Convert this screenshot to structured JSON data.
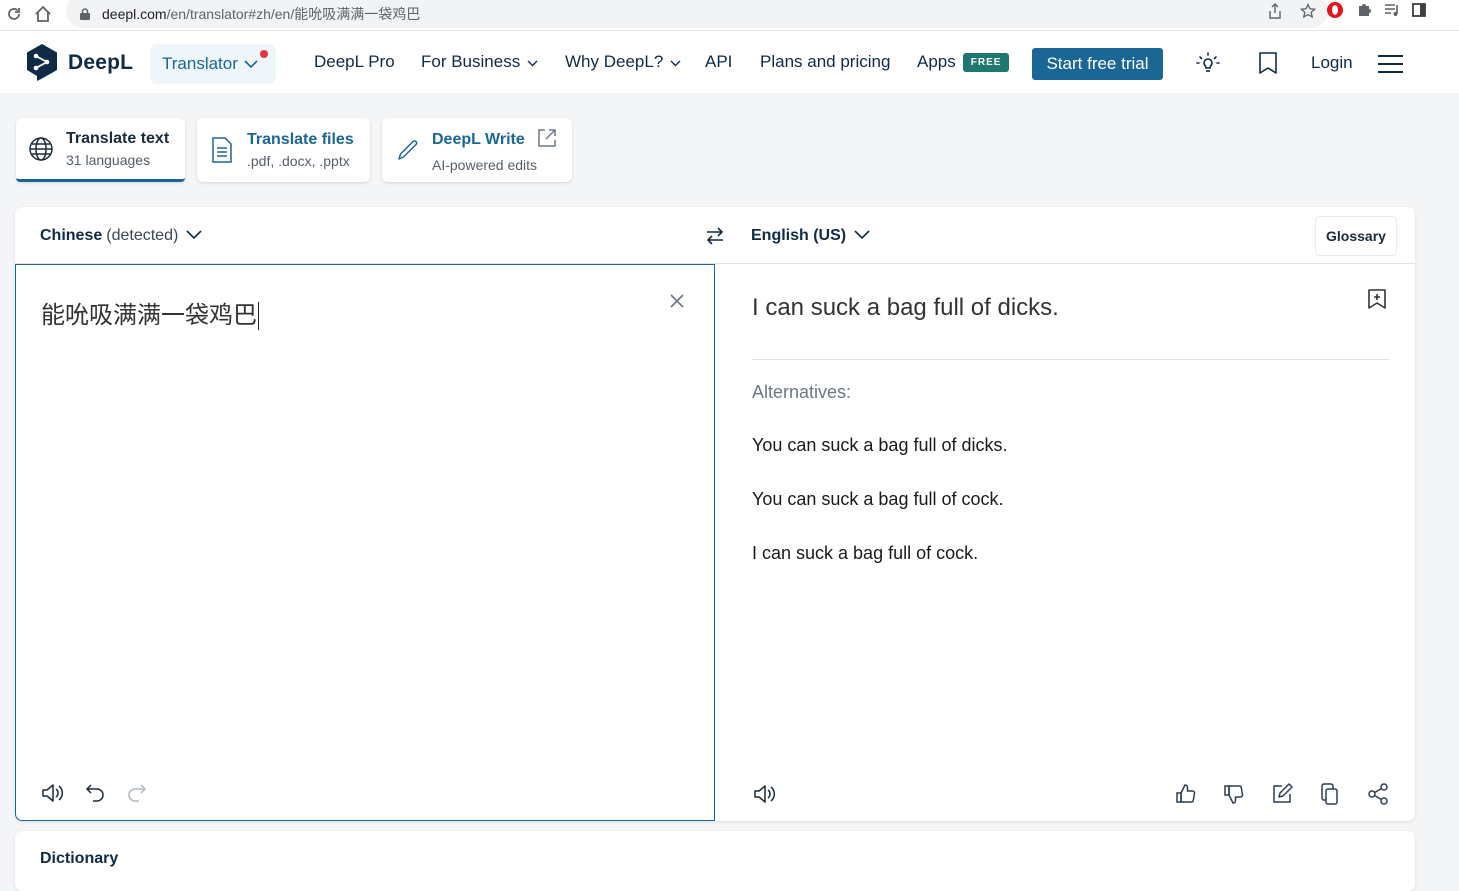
{
  "browser": {
    "url_host": "deepl.com",
    "url_path": "/en/translator#zh/en/能吮吸满满一袋鸡巴",
    "icons": [
      "reload-icon",
      "home-icon",
      "lock-icon",
      "share-icon",
      "star-icon",
      "opera-extension-icon",
      "puzzle-icon",
      "media-icon",
      "sidepanel-icon"
    ]
  },
  "header": {
    "logo_text": "DeepL",
    "translator_label": "Translator",
    "nav": {
      "pro": "DeepL Pro",
      "business": "For Business",
      "why": "Why DeepL?",
      "api": "API",
      "pricing": "Plans and pricing",
      "apps": "Apps",
      "apps_badge": "FREE"
    },
    "cta": "Start free trial",
    "login": "Login",
    "colors": {
      "brand": "#0f2b46",
      "accent": "#1a6695",
      "badge": "#1f7870",
      "notification": "#e0383e"
    }
  },
  "modes": [
    {
      "title": "Translate text",
      "subtitle": "31 languages",
      "active": true
    },
    {
      "title": "Translate files",
      "subtitle": ".pdf, .docx, .pptx",
      "active": false
    },
    {
      "title": "DeepL Write",
      "subtitle": "AI-powered edits",
      "active": false
    }
  ],
  "translator": {
    "source_lang": "Chinese",
    "source_lang_note": "(detected)",
    "target_lang": "English (US)",
    "glossary_label": "Glossary",
    "source_text": "能吮吸满满一袋鸡巴",
    "translation": "I can suck a bag full of dicks.",
    "alternatives_label": "Alternatives:",
    "alternatives": [
      "You can suck a bag full of dicks.",
      "You can suck a bag full of cock.",
      "I can suck a bag full of cock."
    ]
  },
  "dictionary": {
    "title": "Dictionary"
  }
}
